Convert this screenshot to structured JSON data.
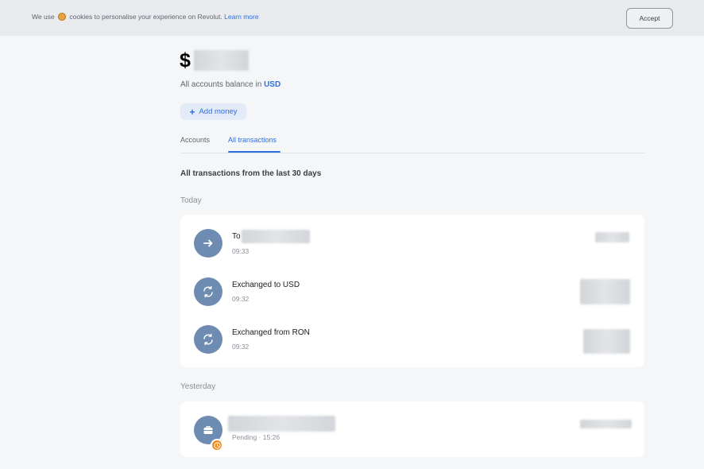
{
  "cookie_bar": {
    "text_before": "We use",
    "text_after": "cookies to personalise your experience on Revolut.",
    "link": "Learn more",
    "accept_label": "Accept"
  },
  "balance": {
    "symbol": "$",
    "caption": "All accounts balance in",
    "currency": "USD"
  },
  "actions": {
    "add_money_icon": "+",
    "add_money_label": "Add money"
  },
  "tabs": [
    {
      "label": "Accounts",
      "active": false
    },
    {
      "label": "All transactions",
      "active": true
    }
  ],
  "section_title": "All transactions from the last 30 days",
  "groups": [
    {
      "label": "Today",
      "transactions": [
        {
          "icon": "arrow-right-icon",
          "title": "To",
          "time": "09:33"
        },
        {
          "icon": "exchange-icon",
          "title": "Exchanged to USD",
          "time": "09:32"
        },
        {
          "icon": "exchange-icon",
          "title": "Exchanged from RON",
          "time": "09:32"
        }
      ]
    },
    {
      "label": "Yesterday",
      "transactions": [
        {
          "icon": "briefcase-icon",
          "badge_icon": "clock-icon",
          "status": "Pending",
          "separator": "·",
          "time": "15:26"
        }
      ]
    }
  ],
  "colors": {
    "accent": "#2f6fde",
    "icon_bg": "#6e8bb1",
    "pending_badge": "#f08a18"
  }
}
